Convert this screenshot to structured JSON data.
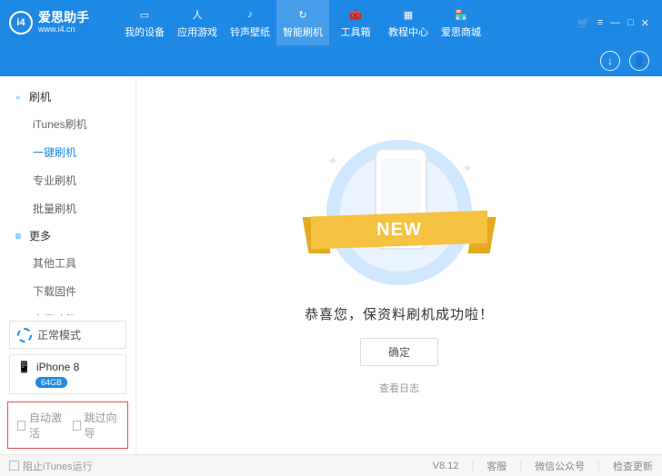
{
  "app": {
    "name": "爱思助手",
    "url": "www.i4.cn",
    "logo_text": "i4"
  },
  "nav": [
    {
      "icon": "▭",
      "label": "我的设备"
    },
    {
      "icon": "人",
      "label": "应用游戏"
    },
    {
      "icon": "♪",
      "label": "铃声壁纸"
    },
    {
      "icon": "↻",
      "label": "智能刷机"
    },
    {
      "icon": "🧰",
      "label": "工具箱"
    },
    {
      "icon": "▦",
      "label": "教程中心"
    },
    {
      "icon": "🏪",
      "label": "爱思商城"
    }
  ],
  "win": {
    "cart": "🛒",
    "menu": "≡",
    "min": "—",
    "max": "□",
    "close": "✕"
  },
  "userbar": {
    "download_icon": "↓",
    "user_icon": "👤"
  },
  "sidebar": {
    "groups": [
      {
        "icon": "▫",
        "title": "刷机",
        "items": [
          "iTunes刷机",
          "一键刷机",
          "专业刷机",
          "批量刷机"
        ],
        "active_index": 1
      },
      {
        "icon": "≡",
        "title": "更多",
        "items": [
          "其他工具",
          "下载固件",
          "高级功能"
        ],
        "active_index": -1
      }
    ],
    "mode": {
      "label": "正常模式"
    },
    "device": {
      "name": "iPhone 8",
      "storage": "64GB",
      "icon": "📱"
    },
    "options": {
      "auto_activate": "自动激活",
      "skip_guide": "跳过向导"
    }
  },
  "main": {
    "ribbon_text": "NEW",
    "success_text": "恭喜您，保资料刷机成功啦！",
    "ok_label": "确定",
    "log_label": "查看日志"
  },
  "footer": {
    "stop_itunes": "阻止iTunes运行",
    "version": "V8.12",
    "support": "客服",
    "wechat": "微信公众号",
    "update": "检查更新"
  }
}
